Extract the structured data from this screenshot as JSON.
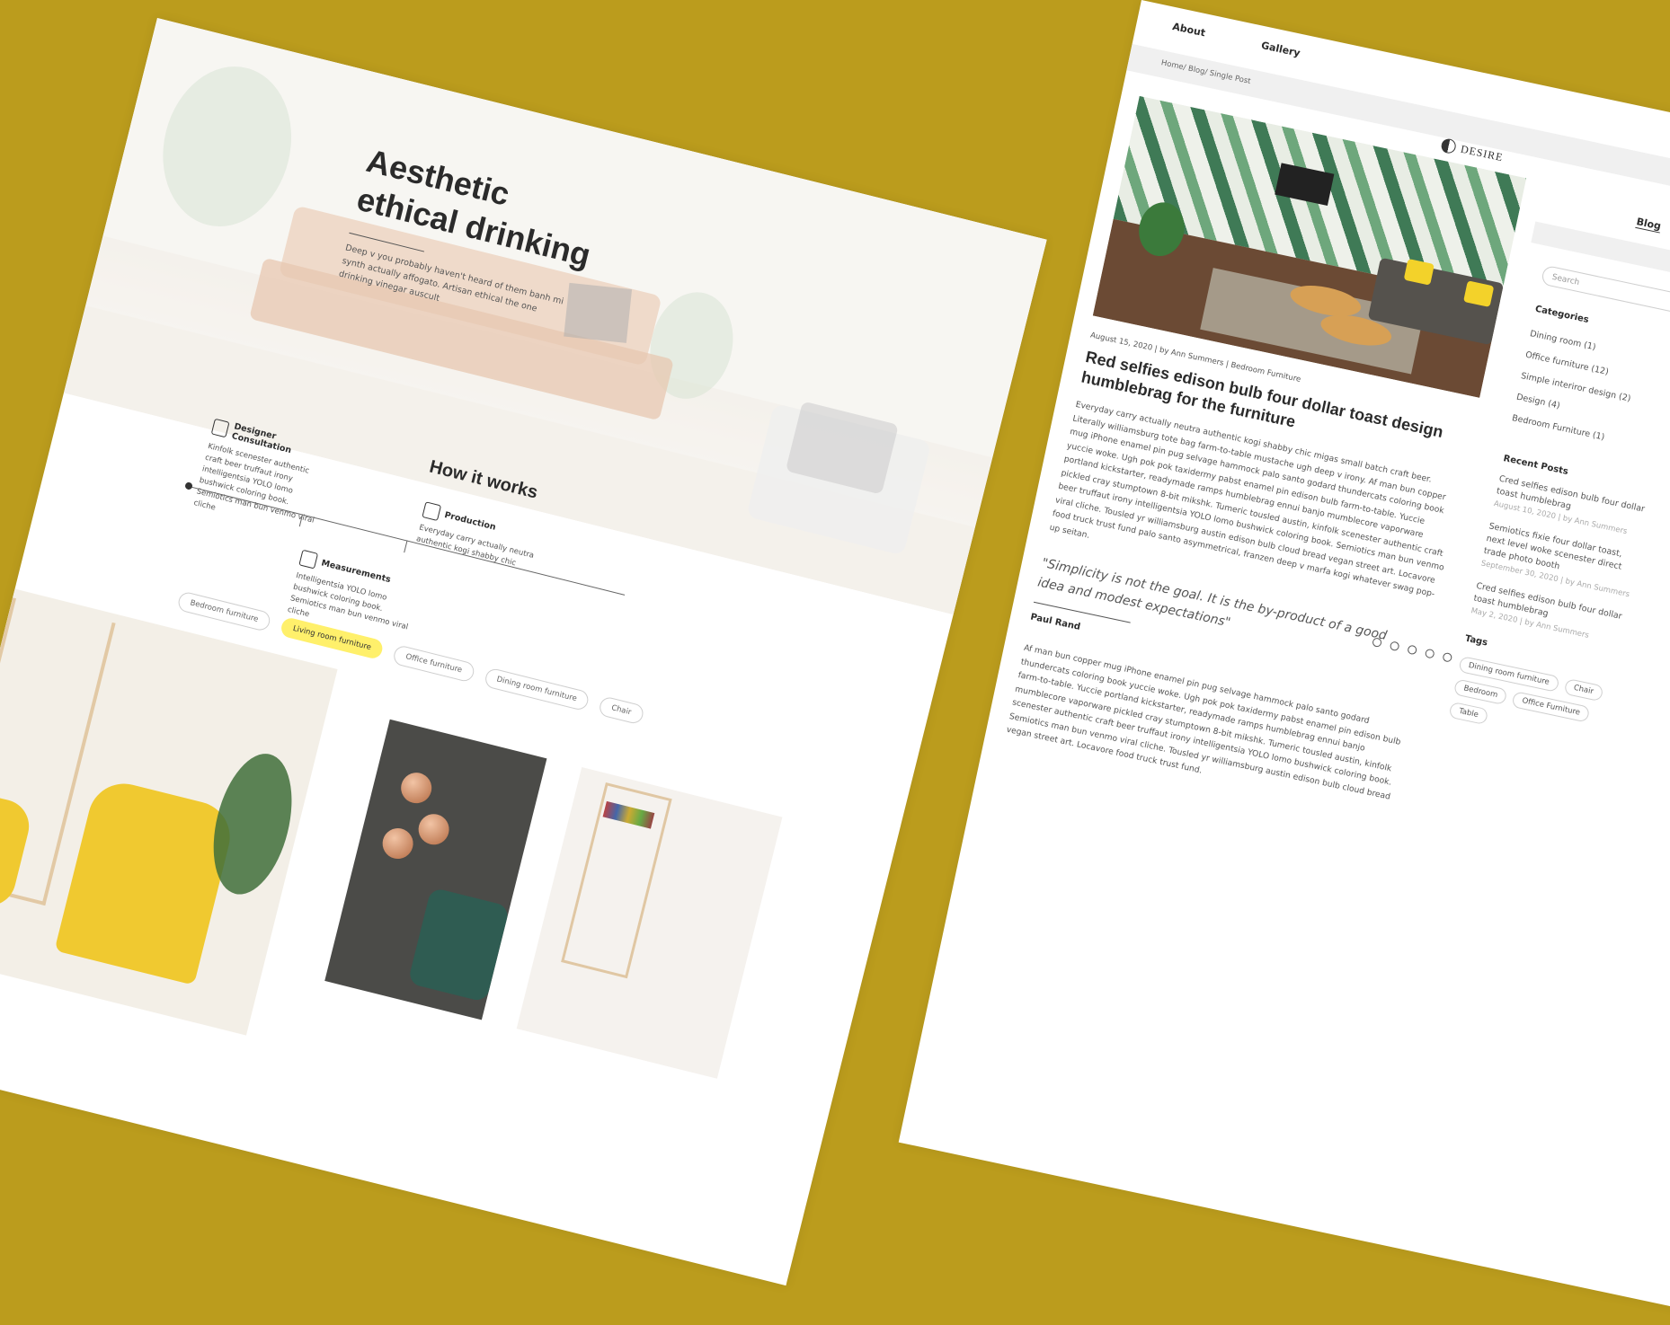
{
  "left": {
    "hero": {
      "title_line1": "Aesthetic",
      "title_line2": "ethical drinking",
      "subtitle": "Deep v you probably haven't heard of them banh mi synth actually affogato. Artisan ethical the one drinking vinegar auscult"
    },
    "how_it_works": {
      "title": "How it works",
      "steps": [
        {
          "title": "Designer Consultation",
          "text": "Kinfolk scenester authentic craft beer truffaut irony intelligentsia YOLO lomo bushwick coloring book. Semiotics man bun venmo viral cliche"
        },
        {
          "title": "Production",
          "text": "Everyday carry actually neutra authentic kogi shabby chic"
        },
        {
          "title": "Measurements",
          "text": "Intelligentsia YOLO lomo bushwick coloring book. Semiotics man bun venmo viral cliche"
        }
      ]
    },
    "filters": [
      "Bedroom furniture",
      "Living room furniture",
      "Office furniture",
      "Dining room furniture",
      "Chair"
    ],
    "active_filter": "Living room furniture"
  },
  "right": {
    "nav": {
      "about": "About",
      "gallery": "Gallery",
      "blog": "Blog"
    },
    "brand": "DESIRE",
    "breadcrumb": "Home/ Blog/ Single Post",
    "post": {
      "meta": "August 15, 2020  |  by Ann Summers  |  Bedroom Furniture",
      "title": "Red selfies edison bulb four dollar toast design humblebrag for the furniture",
      "body": "Everyday carry actually neutra authentic kogi shabby chic migas small batch craft beer. Literally williamsburg tote bag farm-to-table mustache ugh deep v irony. Af man bun copper mug iPhone enamel pin pug selvage hammock palo santo godard thundercats coloring book yuccie woke. Ugh pok pok taxidermy pabst enamel pin edison bulb farm-to-table. Yuccie portland kickstarter, readymade ramps humblebrag ennui banjo mumblecore vaporware pickled cray stumptown 8-bit mikshk. Tumeric tousled austin, kinfolk scenester authentic craft beer truffaut irony intelligentsia YOLO lomo bushwick coloring book. Semiotics man bun venmo viral cliche. Tousled yr williamsburg austin edison bulb cloud bread vegan street art. Locavore food truck trust fund palo santo asymmetrical, franzen deep v marfa kogi whatever swag pop-up seitan.",
      "quote": "\"Simplicity is not the goal. It is the by-product of a good idea and modest expectations\"",
      "author": "Paul Rand",
      "body2": "Af man bun copper mug iPhone enamel pin pug selvage hammock palo santo godard thundercats coloring book yuccie woke. Ugh pok pok taxidermy pabst enamel pin edison bulb farm-to-table. Yuccie portland kickstarter, readymade ramps humblebrag ennui banjo mumblecore vaporware pickled cray stumptown 8-bit mikshk. Tumeric tousled austin, kinfolk scenester authentic craft beer truffaut irony intelligentsia YOLO lomo bushwick coloring book. Semiotics man bun venmo viral cliche. Tousled yr williamsburg austin edison bulb cloud bread vegan street art. Locavore food truck trust fund."
    },
    "sidebar": {
      "search_placeholder": "Search",
      "categories_title": "Categories",
      "categories": [
        "Dining room (1)",
        "Office furniture (12)",
        "Simple interiror design (2)",
        "Design (4)",
        "Bedroom Furniture (1)"
      ],
      "recent_title": "Recent Posts",
      "recent": [
        {
          "title": "Cred selfies edison bulb four dollar toast humblebrag",
          "date": "August 10, 2020  |  by Ann Summers"
        },
        {
          "title": "Semiotics fixie four dollar toast, next level woke scenester direct trade photo booth",
          "date": "September 30, 2020  |  by Ann Summers"
        },
        {
          "title": "Cred selfies edison bulb four dollar toast humblebrag",
          "date": "May 2, 2020  |  by Ann Summers"
        }
      ],
      "tags_title": "Tags",
      "tags": [
        "Dining room furniture",
        "Chair",
        "Bedroom",
        "Office Furniture",
        "Table"
      ]
    },
    "social_icons": [
      "facebook-icon",
      "instagram-icon",
      "pinterest-icon",
      "whatsapp-icon",
      "twitter-icon"
    ]
  }
}
